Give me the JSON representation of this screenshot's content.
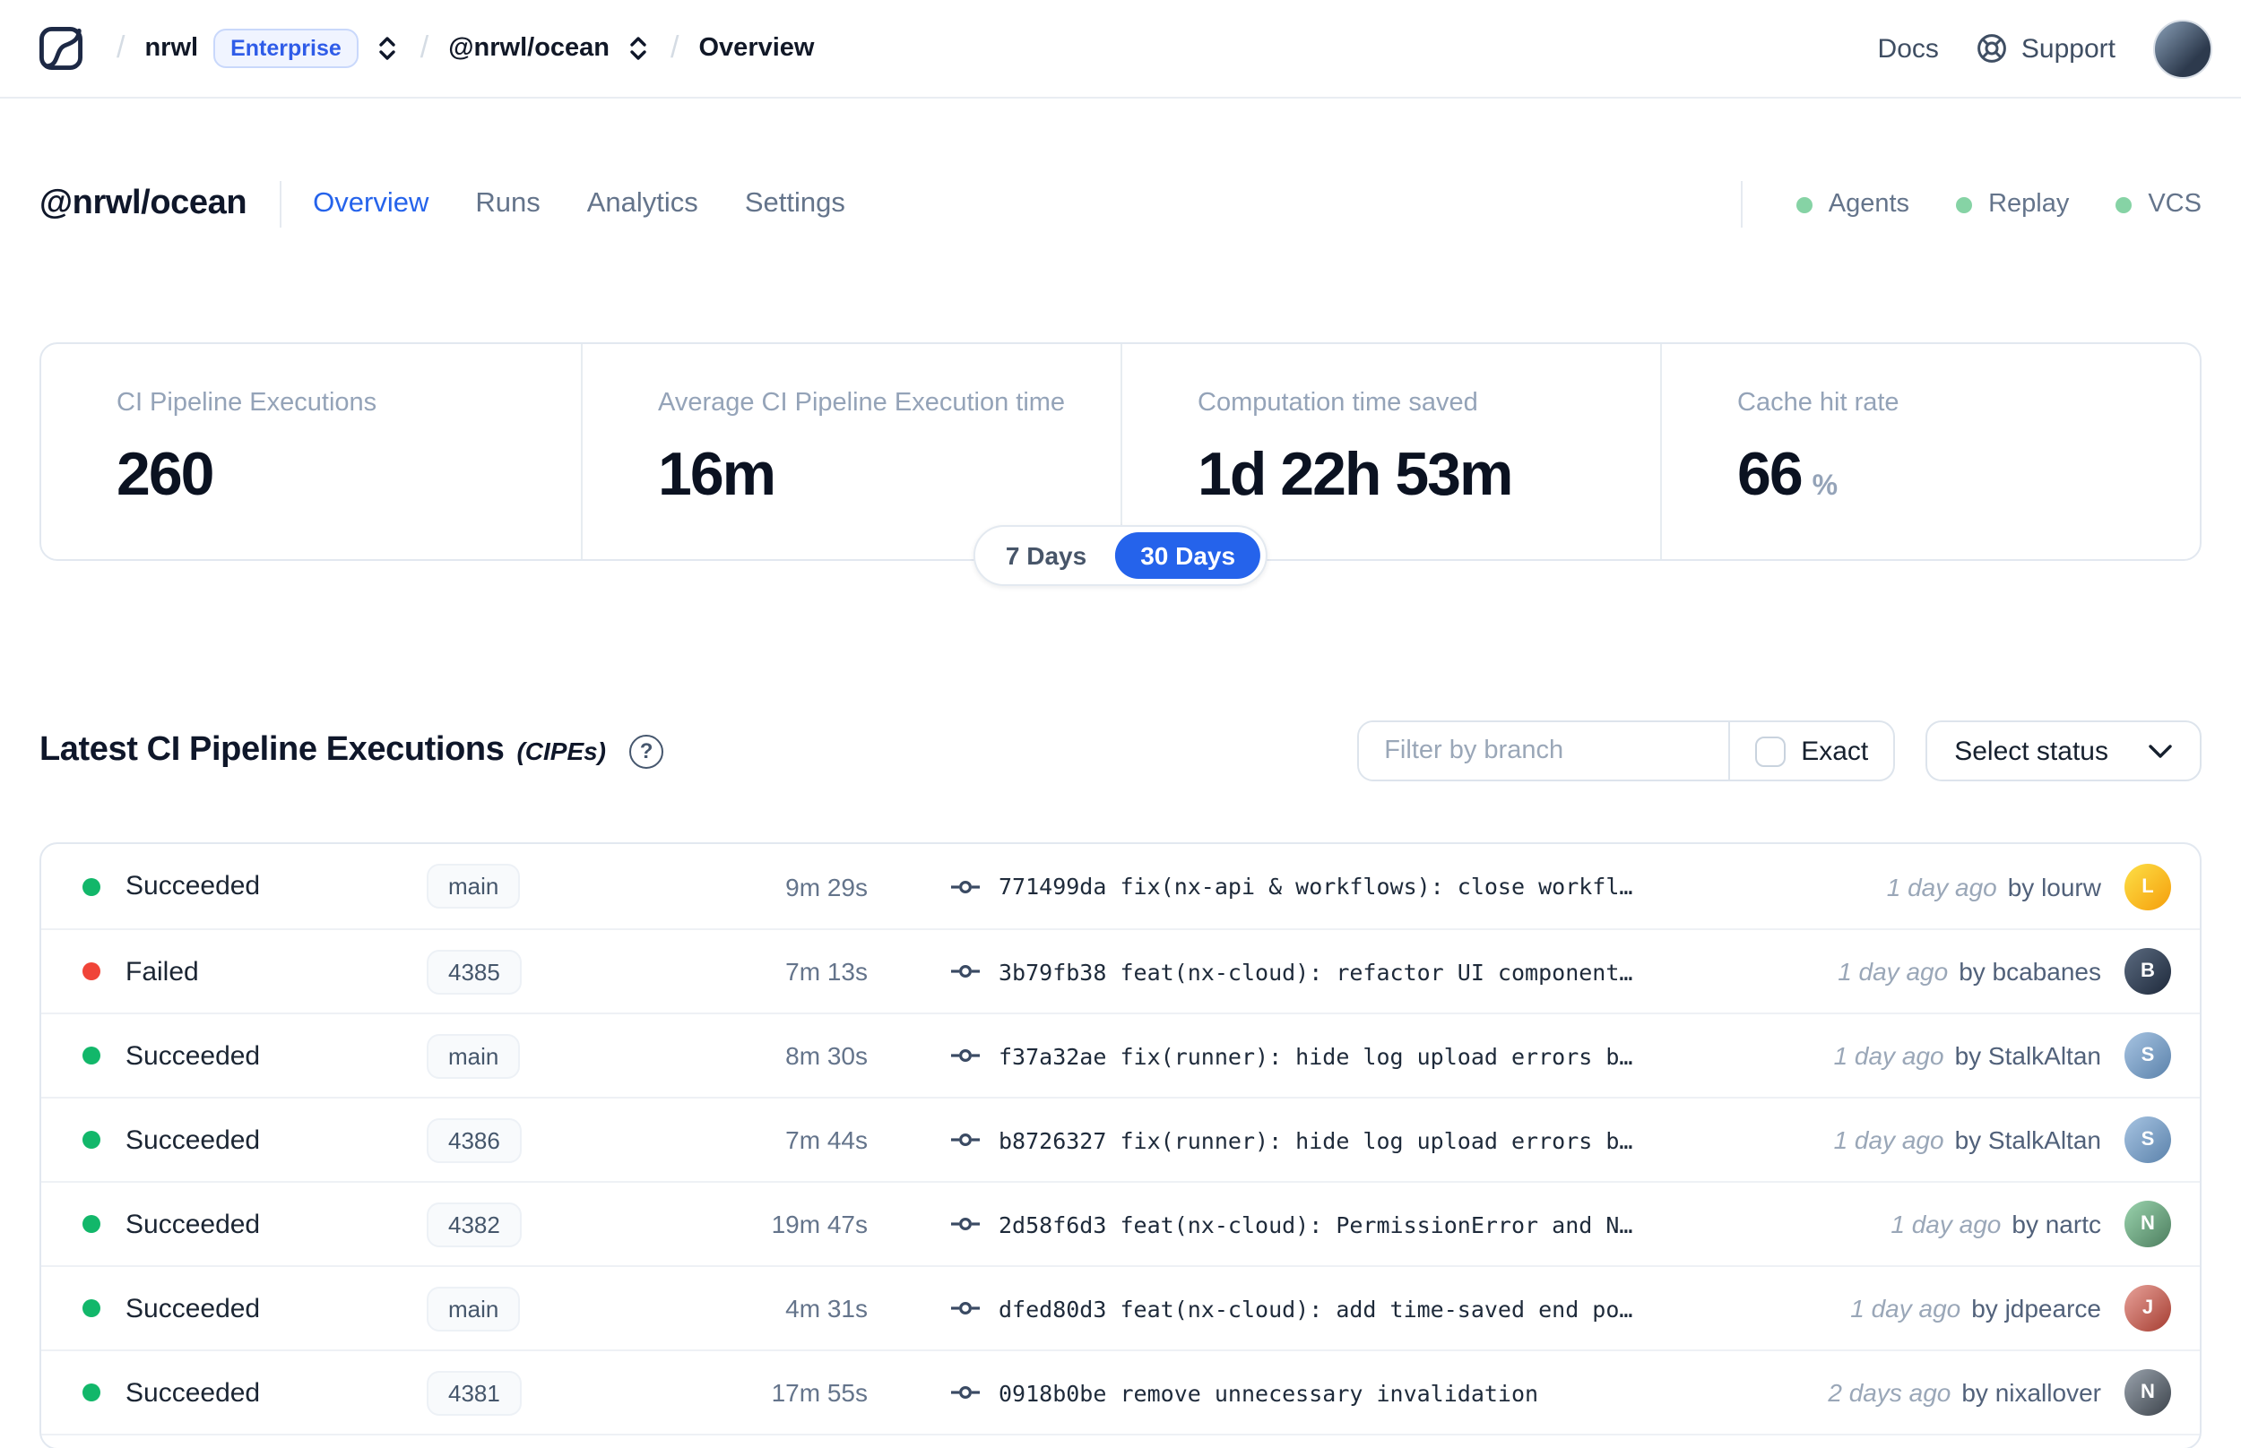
{
  "topbar": {
    "breadcrumb": {
      "separator": "/",
      "org": "nrwl",
      "org_badge": "Enterprise",
      "workspace": "@nrwl/ocean",
      "page": "Overview"
    },
    "docs_label": "Docs",
    "support_label": "Support"
  },
  "header": {
    "title": "@nrwl/ocean",
    "tabs": [
      {
        "label": "Overview",
        "active": true
      },
      {
        "label": "Runs",
        "active": false
      },
      {
        "label": "Analytics",
        "active": false
      },
      {
        "label": "Settings",
        "active": false
      }
    ],
    "indicators": [
      {
        "label": "Agents"
      },
      {
        "label": "Replay"
      },
      {
        "label": "VCS"
      }
    ]
  },
  "stats": {
    "cards": [
      {
        "label": "CI Pipeline Executions",
        "value": "260",
        "suffix": ""
      },
      {
        "label": "Average CI Pipeline Execution time",
        "value": "16m",
        "suffix": ""
      },
      {
        "label": "Computation time saved",
        "value": "1d 22h 53m",
        "suffix": ""
      },
      {
        "label": "Cache hit rate",
        "value": "66",
        "suffix": "%"
      }
    ]
  },
  "range_toggle": {
    "options": [
      {
        "label": "7 Days",
        "active": false
      },
      {
        "label": "30 Days",
        "active": true
      }
    ]
  },
  "cipe": {
    "title": "Latest CI Pipeline Executions",
    "subtitle": "(CIPEs)",
    "help_glyph": "?",
    "filter_placeholder": "Filter by branch",
    "exact_label": "Exact",
    "select_status_label": "Select status",
    "rows": [
      {
        "status": "Succeeded",
        "status_key": "succeeded",
        "branch": "main",
        "duration": "9m 29s",
        "commit_hash": "771499da",
        "commit_message": "fix(nx-api & workflows): close workfl…",
        "time_ago": "1 day ago",
        "author": "by lourw",
        "avatar_initial": "L"
      },
      {
        "status": "Failed",
        "status_key": "failed",
        "branch": "4385",
        "duration": "7m 13s",
        "commit_hash": "3b79fb38",
        "commit_message": "feat(nx-cloud): refactor UI component…",
        "time_ago": "1 day ago",
        "author": "by bcabanes",
        "avatar_initial": "B"
      },
      {
        "status": "Succeeded",
        "status_key": "succeeded",
        "branch": "main",
        "duration": "8m 30s",
        "commit_hash": "f37a32ae",
        "commit_message": "fix(runner): hide log upload errors b…",
        "time_ago": "1 day ago",
        "author": "by StalkAltan",
        "avatar_initial": "S"
      },
      {
        "status": "Succeeded",
        "status_key": "succeeded",
        "branch": "4386",
        "duration": "7m 44s",
        "commit_hash": "b8726327",
        "commit_message": "fix(runner): hide log upload errors b…",
        "time_ago": "1 day ago",
        "author": "by StalkAltan",
        "avatar_initial": "S"
      },
      {
        "status": "Succeeded",
        "status_key": "succeeded",
        "branch": "4382",
        "duration": "19m 47s",
        "commit_hash": "2d58f6d3",
        "commit_message": "feat(nx-cloud): PermissionError and N…",
        "time_ago": "1 day ago",
        "author": "by nartc",
        "avatar_initial": "N"
      },
      {
        "status": "Succeeded",
        "status_key": "succeeded",
        "branch": "main",
        "duration": "4m 31s",
        "commit_hash": "dfed80d3",
        "commit_message": "feat(nx-cloud): add time-saved end po…",
        "time_ago": "1 day ago",
        "author": "by jdpearce",
        "avatar_initial": "J"
      },
      {
        "status": "Succeeded",
        "status_key": "succeeded",
        "branch": "4381",
        "duration": "17m 55s",
        "commit_hash": "0918b0be",
        "commit_message": "remove unnecessary invalidation",
        "time_ago": "2 days ago",
        "author": "by nixallover",
        "avatar_initial": "N"
      }
    ]
  },
  "colors": {
    "accent_blue": "#2563eb",
    "success_green": "#12b76a",
    "failed_red": "#f04438",
    "indicator_green": "#86d3a5"
  }
}
